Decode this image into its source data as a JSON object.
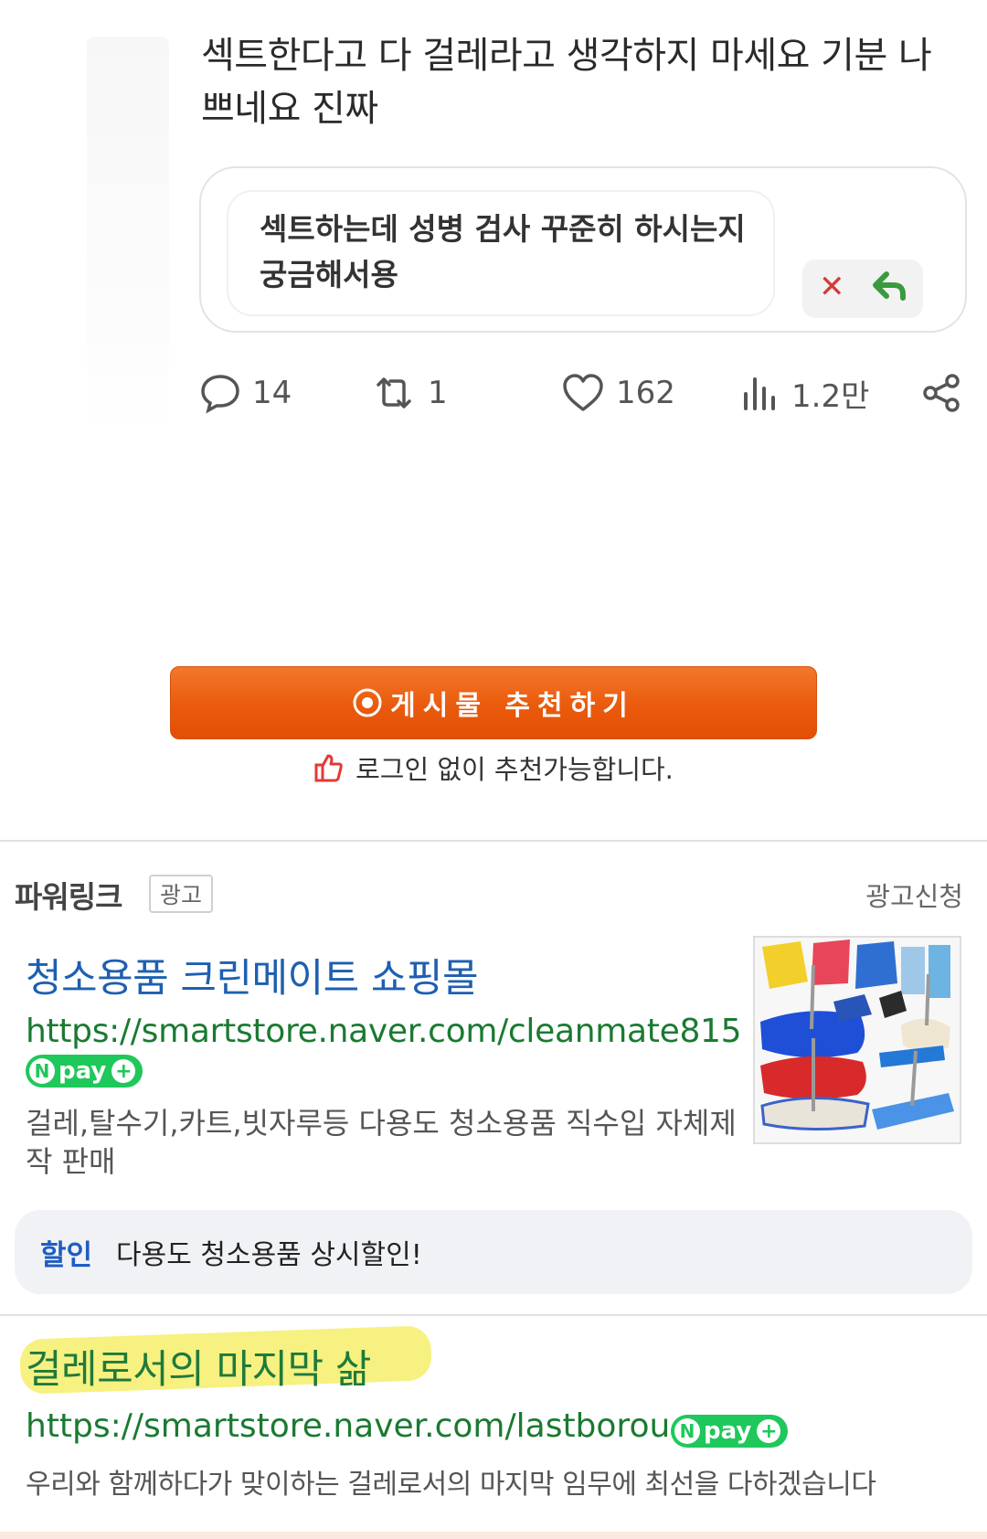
{
  "tweet": {
    "text_line1": "섹트한다고 다 걸레라고 생각하지 마세요 기분 나",
    "text_line2": "쁘네요 진짜",
    "quote_line1": "섹트하는데 성병 검사 꾸준히 하시는지",
    "quote_line2": "궁금해서용",
    "replies": "14",
    "retweets": "1",
    "likes": "162",
    "views": "1.2만"
  },
  "recommend": {
    "button_label": "게시물 추천하기",
    "login_note": "로그인 없이 추천가능합니다."
  },
  "powerlink": {
    "title": "파워링크",
    "ad_badge": "광고",
    "apply_label": "광고신청",
    "ads": [
      {
        "title": "청소용품 크린메이트 쇼핑몰",
        "url": "https://smartstore.naver.com/cleanmate815",
        "npay": "pay",
        "desc_line1": "걸레,탈수기,카트,빗자루등 다용도 청소용품 직수입 자체제",
        "desc_line2": "작 판매",
        "promo_tag": "할인",
        "promo_text": "다용도 청소용품 상시할인!"
      },
      {
        "title": "걸레로서의 마지막 삶",
        "url": "https://smartstore.naver.com/lastborou",
        "npay": "pay",
        "desc": "우리와 함께하다가 맞이하는 걸레로서의 마지막 임무에 최선을 다하겠습니다"
      }
    ]
  },
  "colors": {
    "orange": "#e95a0c",
    "link_blue": "#1e5fb0",
    "url_green": "#1a7a31",
    "npay_green": "#1ec85a",
    "highlight": "#f6f07a"
  }
}
